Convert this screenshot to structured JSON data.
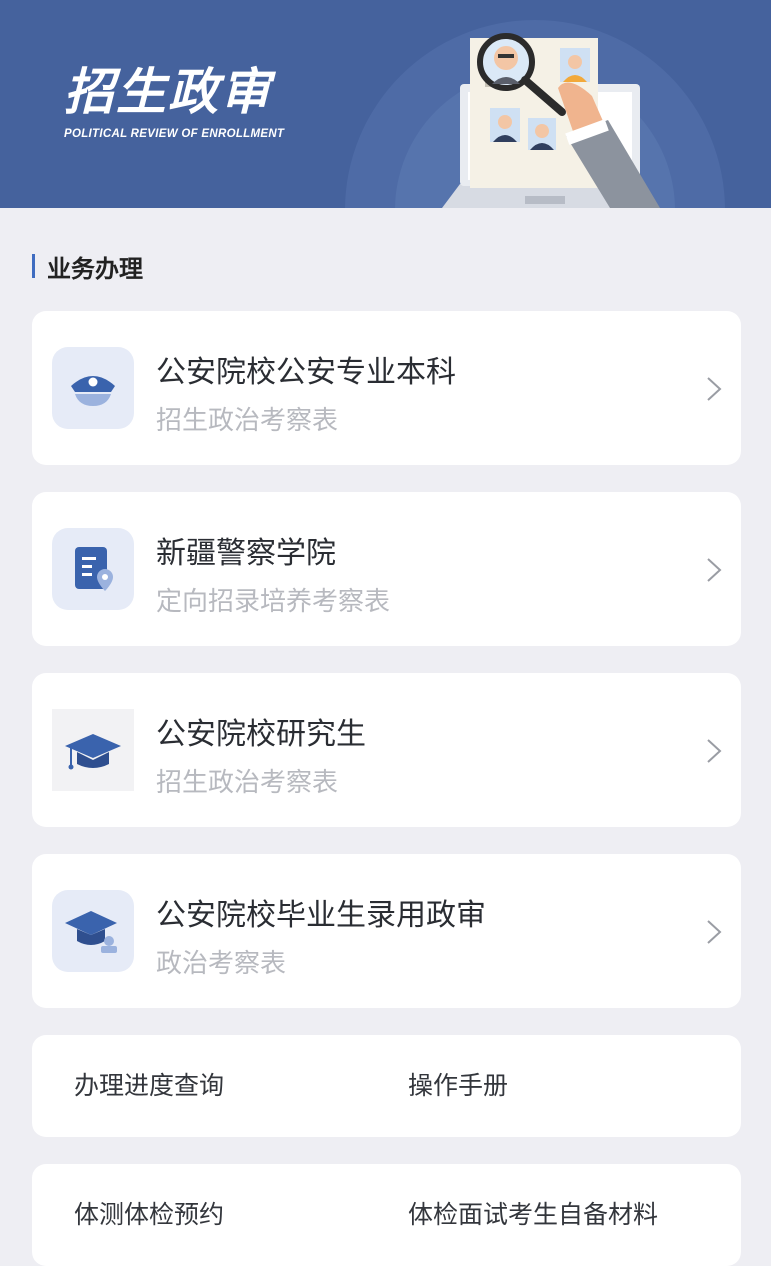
{
  "banner": {
    "title": "招生政审",
    "subtitle": "POLITICAL REVIEW OF ENROLLMENT"
  },
  "section": {
    "title": "业务办理"
  },
  "services": [
    {
      "title": "公安院校公安专业本科",
      "subtitle": "招生政治考察表",
      "icon": "police-cap-icon"
    },
    {
      "title": "新疆警察学院",
      "subtitle": "定向招录培养考察表",
      "icon": "location-document-icon"
    },
    {
      "title": "公安院校研究生",
      "subtitle": "招生政治考察表",
      "icon": "graduation-cap-icon"
    },
    {
      "title": "公安院校毕业生录用政审",
      "subtitle": "政治考察表",
      "icon": "graduate-stamp-icon"
    }
  ],
  "links": [
    {
      "left": "办理进度查询",
      "right": "操作手册"
    },
    {
      "left": "体测体检预约",
      "right": "体检面试考生自备材料"
    }
  ],
  "colors": {
    "banner": "#45629d",
    "accent": "#3f6cc0",
    "page_bg": "#eeeef3"
  }
}
